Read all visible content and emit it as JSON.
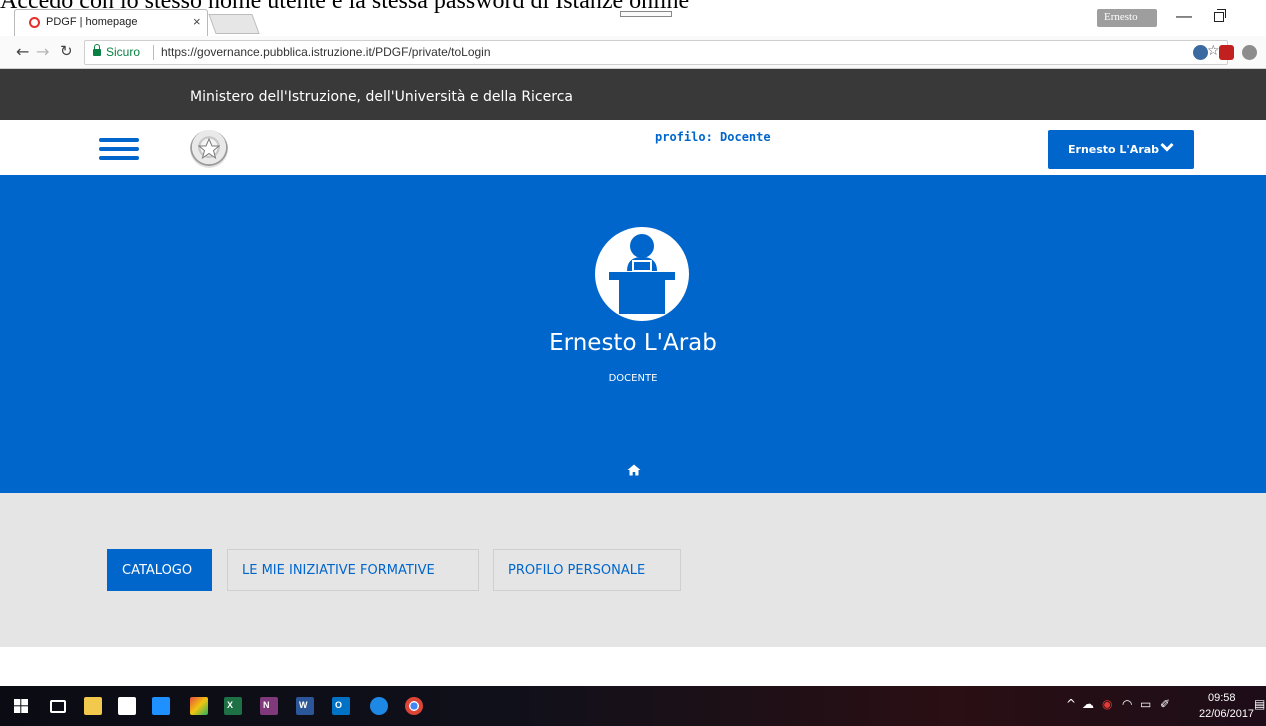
{
  "document_caption": "Accedo con lo stesso nome utente e la stessa password di Istanze online",
  "browser": {
    "tab_title": "PDGF | homepage",
    "tab_close": "×",
    "window_user": "Ernesto",
    "security_label": "Sicuro",
    "url": "https://governance.pubblica.istruzione.it/PDGF/private/toLogin"
  },
  "site": {
    "ministry_header": "Ministero dell'Istruzione, dell'Università e della Ricerca",
    "profile_label": "profilo: Docente",
    "user_menu_label": "Ernesto L'Arab"
  },
  "hero": {
    "user_name": "Ernesto L'Arab",
    "user_role": "DOCENTE"
  },
  "tabs": [
    {
      "label": "CATALOGO",
      "active": true
    },
    {
      "label": "LE MIE INIZIATIVE FORMATIVE",
      "active": false
    },
    {
      "label": "PROFILO PERSONALE",
      "active": false
    }
  ],
  "taskbar": {
    "time": "09:58",
    "date": "22/06/2017",
    "apps": [
      "start",
      "task-view",
      "file-explorer",
      "store",
      "dropbox",
      "photos",
      "excel",
      "onenote",
      "word",
      "outlook",
      "edge",
      "chrome"
    ]
  },
  "colors": {
    "brand_blue": "#0066cc",
    "header_dark": "#393939",
    "tabs_band": "#e5e5e5",
    "secure_green": "#0b8043"
  }
}
